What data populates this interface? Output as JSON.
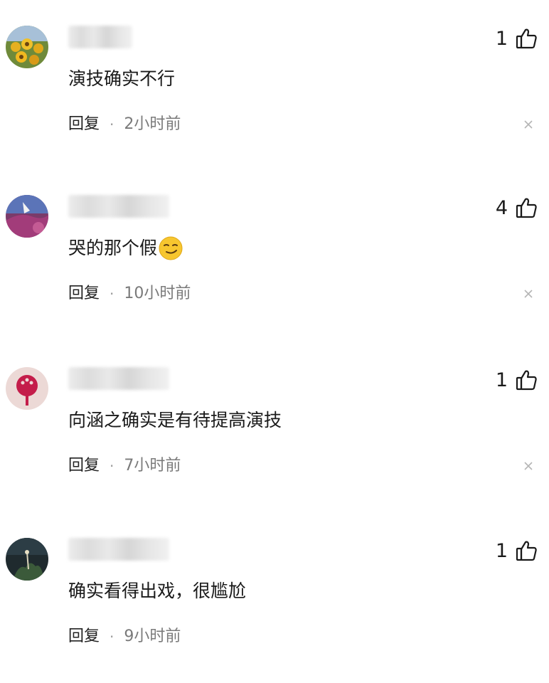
{
  "comments": [
    {
      "content": "演技确实不行",
      "likes": "1",
      "reply_label": "回复",
      "separator": "·",
      "time": "2小时前",
      "username_width_hint": "short"
    },
    {
      "content": "哭的那个假",
      "likes": "4",
      "reply_label": "回复",
      "separator": "·",
      "time": "10小时前",
      "emoji": "smirk-emoji"
    },
    {
      "content": "向涵之确实是有待提高演技",
      "likes": "1",
      "reply_label": "回复",
      "separator": "·",
      "time": "7小时前"
    },
    {
      "content": "确实看得出戏，很尴尬",
      "likes": "1",
      "reply_label": "回复",
      "separator": "·",
      "time": "9小时前"
    }
  ],
  "icons": {
    "like": "thumbs-up-icon",
    "close": "close-icon"
  },
  "colors": {
    "text": "#1a1a1a",
    "meta": "#7a7a7a",
    "close": "#b5b5b5"
  }
}
